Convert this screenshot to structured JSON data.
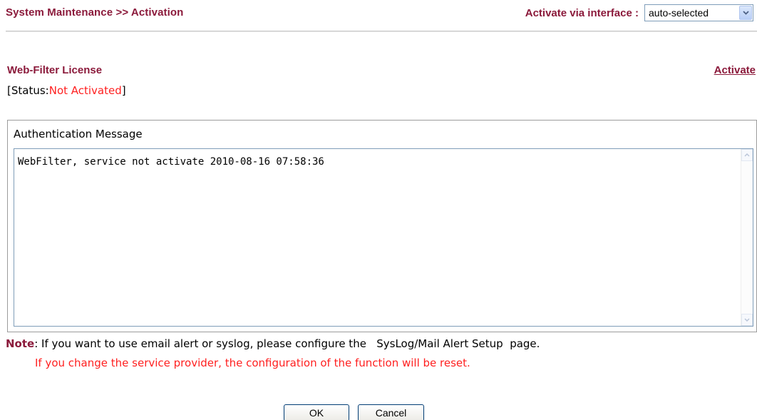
{
  "header": {
    "title": "System Maintenance >> Activation",
    "activate_via_label": "Activate via interface :",
    "interface_select": {
      "selected": "auto-selected"
    }
  },
  "license": {
    "title": "Web-Filter License",
    "activate_link": "Activate",
    "status_prefix": "[Status:",
    "status_value": "Not Activated",
    "status_suffix": "]"
  },
  "auth": {
    "label": "Authentication Message",
    "message": "WebFilter, service not activate 2010-08-16 07:58:36"
  },
  "note": {
    "label": "Note",
    "text": ": If you want to use email alert or syslog, please configure the   SysLog/Mail Alert Setup  page.",
    "warning": "If you change the service provider, the configuration of the function will be reset."
  },
  "buttons": {
    "ok": "OK",
    "cancel": "Cancel"
  },
  "colors": {
    "accent": "#8b1a3b",
    "warning": "#ff2020"
  },
  "icons": {
    "select_arrow": "chevron-down-icon",
    "scroll_up": "arrow-up-icon",
    "scroll_down": "arrow-down-icon"
  }
}
